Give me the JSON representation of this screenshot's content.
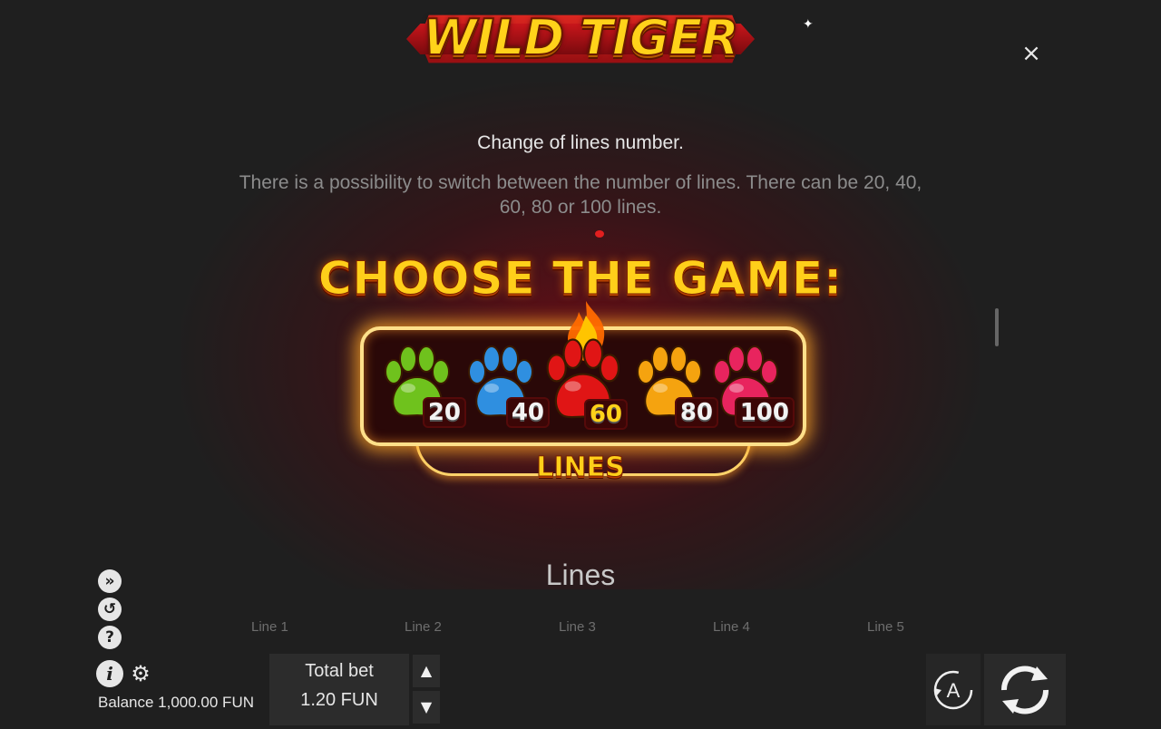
{
  "logo": {
    "text": "WILD TIGER"
  },
  "help": {
    "subtitle": "Change of lines number.",
    "description": "There is a possibility to switch between the number of lines. There can be 20, 40, 60, 80 or 100 lines.",
    "choose_title": "CHOOSE THE GAME:",
    "lines_label": "LINES",
    "paw_options": [
      {
        "value": "20",
        "color": "#6fc21d"
      },
      {
        "value": "40",
        "color": "#2f8fe0"
      },
      {
        "value": "60",
        "color": "#e01515",
        "selected": true
      },
      {
        "value": "80",
        "color": "#f5a30f"
      },
      {
        "value": "100",
        "color": "#e8245e"
      }
    ],
    "section_title": "Lines",
    "line_headers": [
      "Line 1",
      "Line 2",
      "Line 3",
      "Line 4",
      "Line 5"
    ]
  },
  "controls": {
    "close_icon": "×",
    "balance": "Balance 1,000.00 FUN",
    "total_bet_label": "Total bet",
    "total_bet_value": "1.20 FUN",
    "side_icons": [
      "turbo-icon",
      "history-icon",
      "help-icon"
    ],
    "up_arrow": "▲",
    "down_arrow": "▼"
  },
  "colors": {
    "background": "#1f1f1f",
    "gold": "#ffcf1a",
    "panel_border": "#ffe08a"
  }
}
